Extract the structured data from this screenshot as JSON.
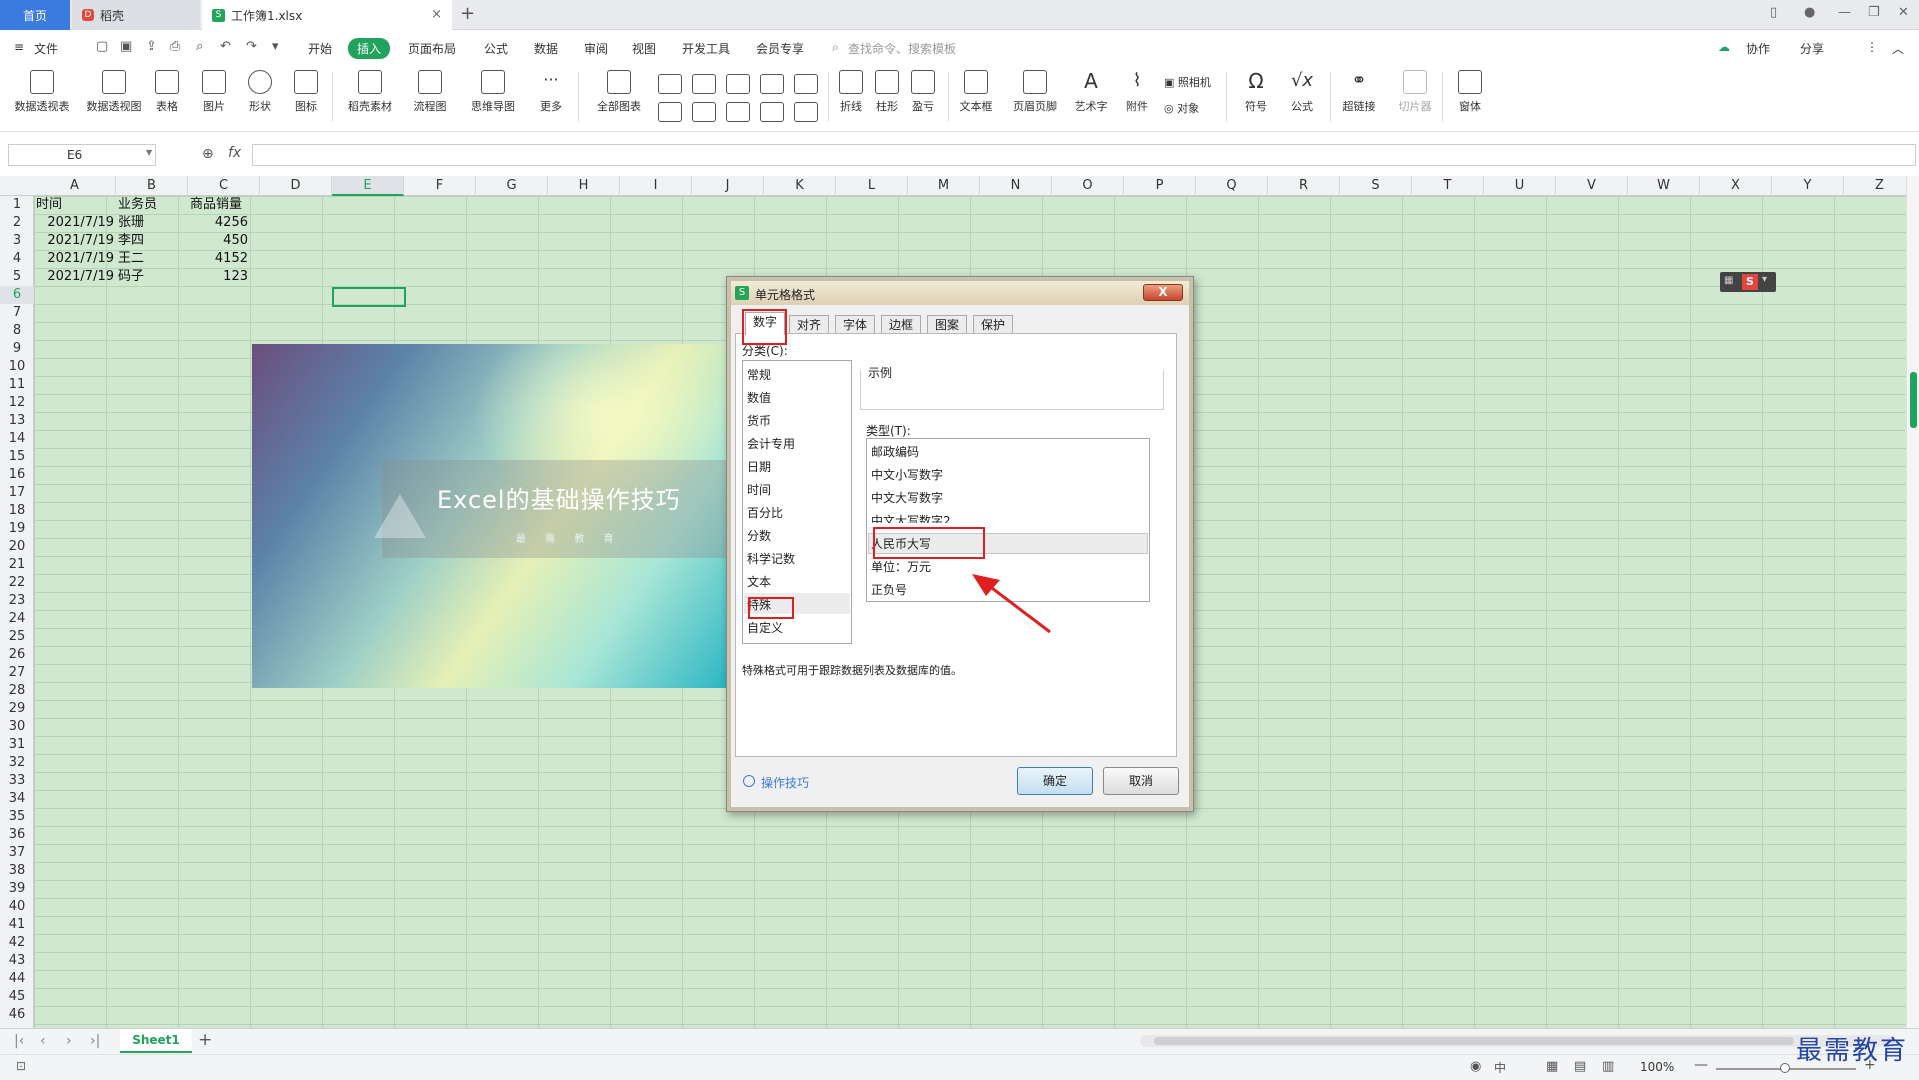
{
  "tabs": {
    "home": "首页",
    "docer": "稻壳",
    "file": "工作簿1.xlsx",
    "add": "+",
    "close": "×"
  },
  "menu": {
    "file": "文件",
    "items": [
      "开始",
      "插入",
      "页面布局",
      "公式",
      "数据",
      "审阅",
      "视图",
      "开发工具",
      "会员专享"
    ],
    "search_placeholder": "查找命令、搜索模板",
    "collab": "协作",
    "share": "分享"
  },
  "ribbon": {
    "items": [
      "数据透视表",
      "数据透视图",
      "表格",
      "图片",
      "形状",
      "图标",
      "稻壳素材",
      "流程图",
      "思维导图",
      "更多",
      "全部图表",
      "折线",
      "柱形",
      "盈亏",
      "文本框",
      "页眉页脚",
      "艺术字",
      "附件",
      "照相机",
      "对象",
      "符号",
      "公式",
      "超链接",
      "切片器",
      "窗体"
    ]
  },
  "formula_bar": {
    "cell_ref": "E6",
    "fx": "fx"
  },
  "columns": [
    "A",
    "B",
    "C",
    "D",
    "E",
    "F",
    "G",
    "H",
    "I",
    "J",
    "K",
    "L",
    "M",
    "N",
    "O",
    "P",
    "Q",
    "R",
    "S",
    "T",
    "U",
    "V",
    "W",
    "X",
    "Y",
    "Z"
  ],
  "rows": [
    "1",
    "2",
    "3",
    "4",
    "5",
    "6",
    "7",
    "8",
    "9",
    "10",
    "11",
    "12",
    "13",
    "14",
    "15",
    "16",
    "17",
    "18",
    "19",
    "20",
    "21",
    "22",
    "23",
    "24",
    "25",
    "26",
    "27",
    "28",
    "29",
    "30",
    "31",
    "32",
    "33",
    "34",
    "35",
    "36",
    "37",
    "38",
    "39",
    "40",
    "41",
    "42",
    "43",
    "44",
    "45",
    "46"
  ],
  "sheet": {
    "headers": [
      "时间",
      "业务员",
      "商品销量"
    ],
    "rows": [
      [
        "2021/7/19",
        "张珊",
        "4256"
      ],
      [
        "2021/7/19",
        "李四",
        "450"
      ],
      [
        "2021/7/19",
        "王二",
        "4152"
      ],
      [
        "2021/7/19",
        "码子",
        "123"
      ]
    ]
  },
  "banner": {
    "title": "Excel的基础操作技巧",
    "subtitle": "最 需 教 育"
  },
  "dialog": {
    "title": "单元格格式",
    "close": "X",
    "tabs": [
      "数字",
      "对齐",
      "字体",
      "边框",
      "图案",
      "保护"
    ],
    "category_label": "分类(C):",
    "categories": [
      "常规",
      "数值",
      "货币",
      "会计专用",
      "日期",
      "时间",
      "百分比",
      "分数",
      "科学记数",
      "文本",
      "特殊",
      "自定义"
    ],
    "sample_label": "示例",
    "type_label": "类型(T):",
    "types": [
      "邮政编码",
      "中文小写数字",
      "中文大写数字",
      "中文大写数字2",
      "人民币大写",
      "单位：万元",
      "正负号"
    ],
    "description": "特殊格式可用于跟踪数据列表及数据库的值。",
    "tips": "操作技巧",
    "ok": "确定",
    "cancel": "取消"
  },
  "sheet_tabs": {
    "name": "Sheet1",
    "add": "+"
  },
  "status": {
    "zoom": "100%"
  },
  "watermark": "最需教育",
  "colors": {
    "accent": "#1fa35d",
    "sheet_bg": "#cfe8cf",
    "highlight": "#e02020"
  }
}
